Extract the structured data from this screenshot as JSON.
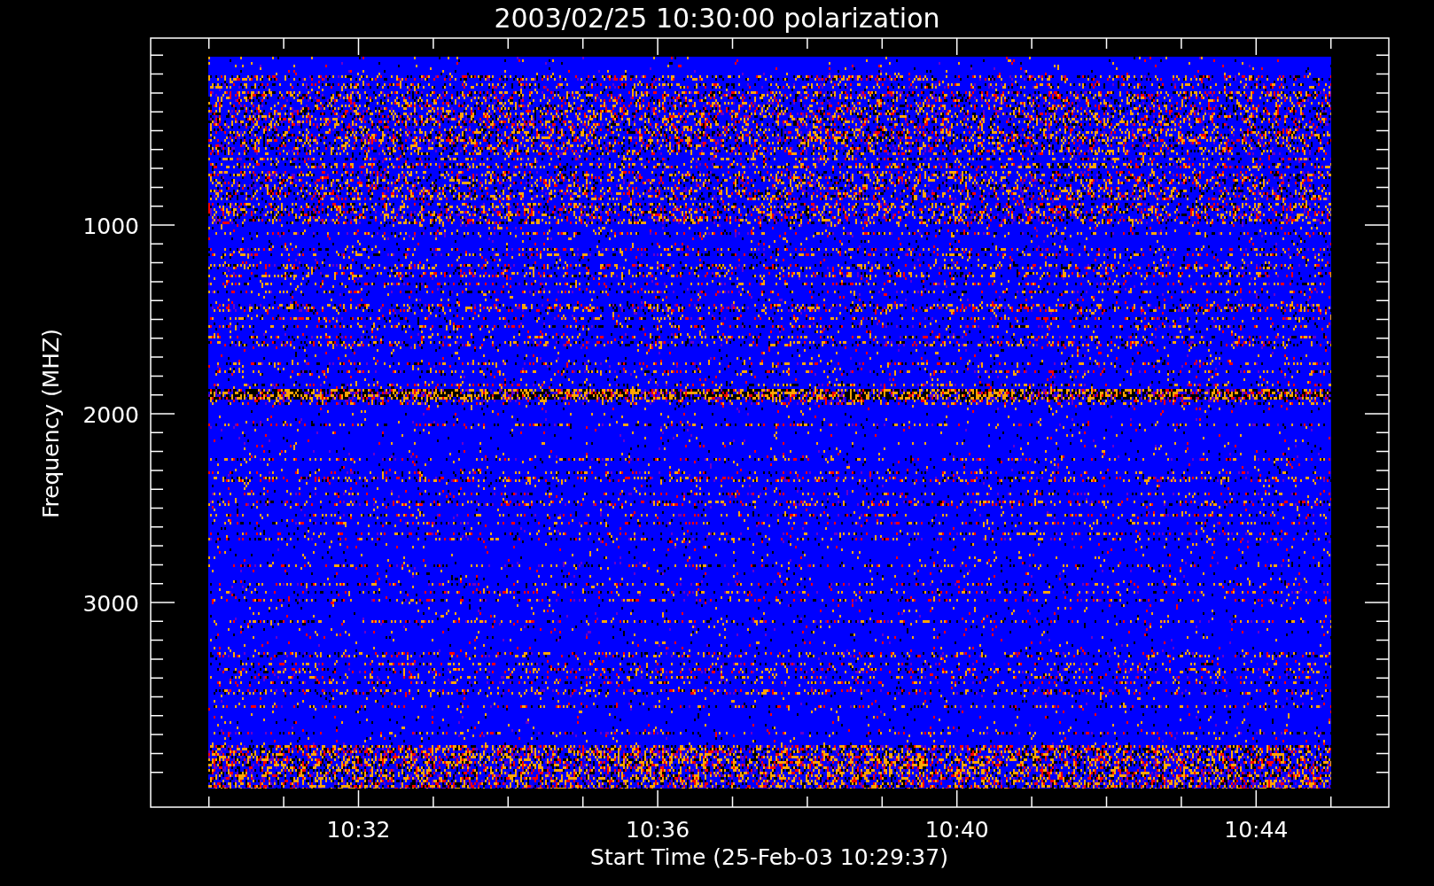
{
  "title": "2003/02/25 10:30:00 polarization",
  "y_axis": {
    "label": "Frequency (MHZ)",
    "ticks": [
      "1000",
      "2000",
      "3000"
    ]
  },
  "x_axis": {
    "label": "Start Time (25-Feb-03 10:29:37)",
    "ticks": [
      "10:32",
      "10:36",
      "10:40",
      "10:44"
    ]
  }
}
